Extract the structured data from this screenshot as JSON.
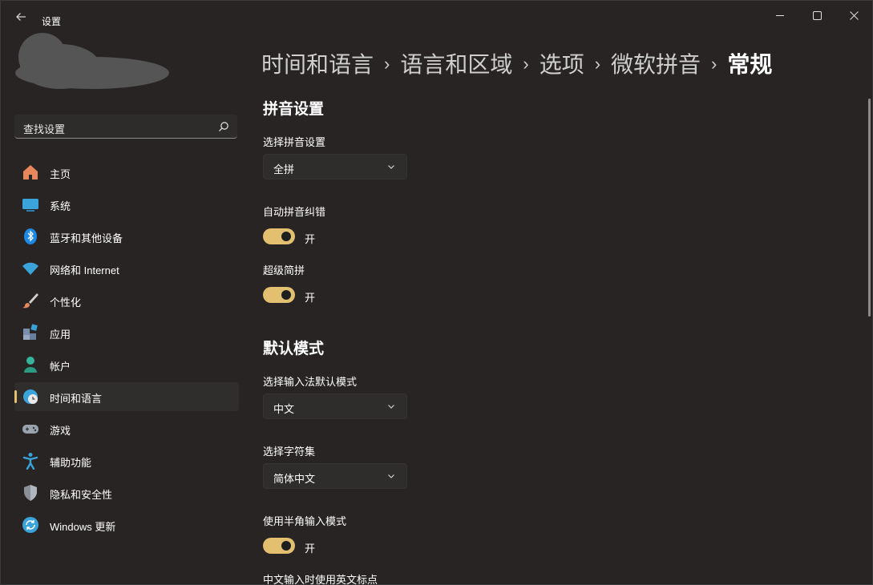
{
  "window": {
    "title": "设置",
    "controls": [
      "minimize-icon",
      "maximize-icon",
      "close-icon"
    ]
  },
  "search": {
    "placeholder": "查找设置"
  },
  "sidebar": {
    "items": [
      {
        "label": "主页",
        "icon": "home-icon",
        "color": "#e8875b"
      },
      {
        "label": "系统",
        "icon": "system-icon",
        "color": "#3aa3d9"
      },
      {
        "label": "蓝牙和其他设备",
        "icon": "bluetooth-icon",
        "color": "#1e88e5"
      },
      {
        "label": "网络和 Internet",
        "icon": "wifi-icon",
        "color": "#3aa3d9"
      },
      {
        "label": "个性化",
        "icon": "brush-icon",
        "color": "#e8875b"
      },
      {
        "label": "应用",
        "icon": "apps-icon",
        "color": "#7a8fb0"
      },
      {
        "label": "帐户",
        "icon": "account-icon",
        "color": "#34b59a"
      },
      {
        "label": "时间和语言",
        "icon": "time-language-icon",
        "color": "#3aa3d9",
        "active": true
      },
      {
        "label": "游戏",
        "icon": "gamepad-icon",
        "color": "#9aa3ad"
      },
      {
        "label": "辅助功能",
        "icon": "accessibility-icon",
        "color": "#3aa3d9"
      },
      {
        "label": "隐私和安全性",
        "icon": "shield-icon",
        "color": "#8a9099"
      },
      {
        "label": "Windows 更新",
        "icon": "update-icon",
        "color": "#3aa3d9"
      }
    ]
  },
  "breadcrumb": [
    "时间和语言",
    "语言和区域",
    "选项",
    "微软拼音",
    "常规"
  ],
  "accent": "#e3c06f",
  "main": {
    "section1": {
      "title": "拼音设置",
      "pinyin_select": {
        "label": "选择拼音设置",
        "value": "全拼"
      },
      "auto_correct": {
        "label": "自动拼音纠错",
        "state": "开"
      },
      "super_abbrev": {
        "label": "超级简拼",
        "state": "开"
      }
    },
    "section2": {
      "title": "默认模式",
      "default_mode": {
        "label": "选择输入法默认模式",
        "value": "中文"
      },
      "charset": {
        "label": "选择字符集",
        "value": "简体中文"
      },
      "half_width": {
        "label": "使用半角输入模式",
        "state": "开"
      },
      "english_punct": {
        "label": "中文输入时使用英文标点"
      }
    }
  }
}
